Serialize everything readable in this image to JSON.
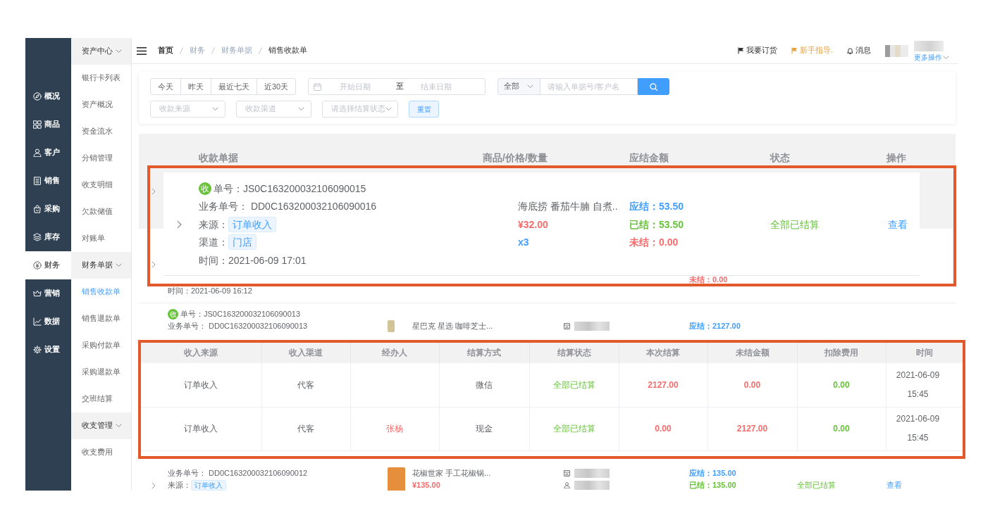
{
  "sidebar": {
    "items": [
      {
        "label": "概况",
        "selected": false
      },
      {
        "label": "商品",
        "selected": false
      },
      {
        "label": "客户",
        "selected": false
      },
      {
        "label": "销售",
        "selected": false
      },
      {
        "label": "采购",
        "selected": false
      },
      {
        "label": "库存",
        "selected": false
      },
      {
        "label": "财务",
        "selected": true
      },
      {
        "label": "营销",
        "selected": false
      },
      {
        "label": "数据",
        "selected": false
      },
      {
        "label": "设置",
        "selected": false
      }
    ]
  },
  "submenu": {
    "groups": [
      {
        "title": "资产中心",
        "expanded": true,
        "items": [
          {
            "label": "银行卡列表",
            "selected": false
          },
          {
            "label": "资产概况",
            "selected": false
          },
          {
            "label": "资金流水",
            "selected": false
          },
          {
            "label": "分销管理",
            "selected": false
          },
          {
            "label": "收支明细",
            "selected": false
          },
          {
            "label": "欠款储值",
            "selected": false
          },
          {
            "label": "对账单",
            "selected": false
          }
        ]
      },
      {
        "title": "财务单据",
        "expanded": true,
        "items": [
          {
            "label": "销售收款单",
            "selected": true
          },
          {
            "label": "销售退款单",
            "selected": false
          },
          {
            "label": "采购付款单",
            "selected": false
          },
          {
            "label": "采购退款单",
            "selected": false
          },
          {
            "label": "交班结算",
            "selected": false
          }
        ]
      },
      {
        "title": "收支管理",
        "expanded": true,
        "items": [
          {
            "label": "收支费用",
            "selected": false
          }
        ]
      }
    ]
  },
  "topbar": {
    "breadcrumb": [
      "首页",
      "财务",
      "财务单据",
      "销售收款单"
    ],
    "actions": [
      {
        "label": "我要订货",
        "highlighted": false
      },
      {
        "label": "新手指导.",
        "highlighted": true
      },
      {
        "label": "消息",
        "highlighted": false
      }
    ],
    "user_menu": "更多操作"
  },
  "filters": {
    "quick_dates": [
      {
        "label": "今天",
        "selected": false
      },
      {
        "label": "昨天",
        "selected": false
      },
      {
        "label": "最近七天",
        "selected": false
      },
      {
        "label": "近30天",
        "selected": false
      }
    ],
    "date_range": {
      "start_placeholder": "开始日期",
      "separator": "至",
      "end_placeholder": "结束日期"
    },
    "search": {
      "scope": "全部",
      "placeholder": "请输入单据号/客户名"
    },
    "selects": [
      {
        "placeholder": "收款来源"
      },
      {
        "placeholder": "收款渠道"
      },
      {
        "placeholder": "请选择结算状态"
      }
    ],
    "reset_button": "重置"
  },
  "table": {
    "columns": [
      "收款单据",
      "商品/价格/数量",
      "应结金额",
      "状态",
      "操作"
    ],
    "rows": [
      {
        "unsettled": "未结：0.00",
        "time": "时间：2021-06-09 16:12"
      },
      {
        "badge": "收",
        "receipt_no": "单号：JS0C163200032106090013",
        "order_no": "业务单号： DD0C163200032106090013",
        "product": "星巴克 星选 咖啡芝士...",
        "due": "应结：2127.00"
      },
      {
        "order_no": "业务单号： DD0C163200032106090012",
        "source_label": "来源：",
        "source": "订单收入",
        "product": "花椒世家 手工花椒锅...",
        "price": "¥135.00",
        "due": "应结：135.00",
        "settled": "已结：135.00",
        "status": "全部已结算",
        "action": "查看"
      }
    ]
  },
  "callouts": [
    {
      "kind": "order_detail",
      "badge": "收",
      "receipt_no": "单号：JS0C163200032106090015",
      "order_no": "业务单号： DD0C163200032106090016",
      "source_label": "来源：",
      "source": "订单收入",
      "channel_label": "渠道：",
      "channel": "门店",
      "time": "时间：2021-06-09 17:01",
      "product": "海底捞 番茄牛腩 自煮..",
      "price": "¥32.00",
      "quantity": "x3",
      "due": "应结：53.50",
      "settled": "已结：53.50",
      "unsettled": "未结：0.00",
      "status": "全部已结算",
      "action": "查看"
    },
    {
      "kind": "settlement_table",
      "columns": [
        "收入来源",
        "收入渠道",
        "经办人",
        "结算方式",
        "结算状态",
        "本次结算",
        "未结金额",
        "扣除费用",
        "时间"
      ],
      "rows": [
        {
          "source": "订单收入",
          "channel": "代客",
          "method": "微信",
          "status": "全部已结算",
          "this_settlement": "2127.00",
          "unsettled": "0.00",
          "deduction": "0.00",
          "time": "2021-06-09 15:45"
        },
        {
          "source": "订单收入",
          "channel": "代客",
          "handler": "张杨",
          "method": "现金",
          "status": "全部已结算",
          "this_settlement": "0.00",
          "unsettled": "2127.00",
          "deduction": "0.00",
          "time": "2021-06-09 15:45"
        }
      ]
    }
  ]
}
